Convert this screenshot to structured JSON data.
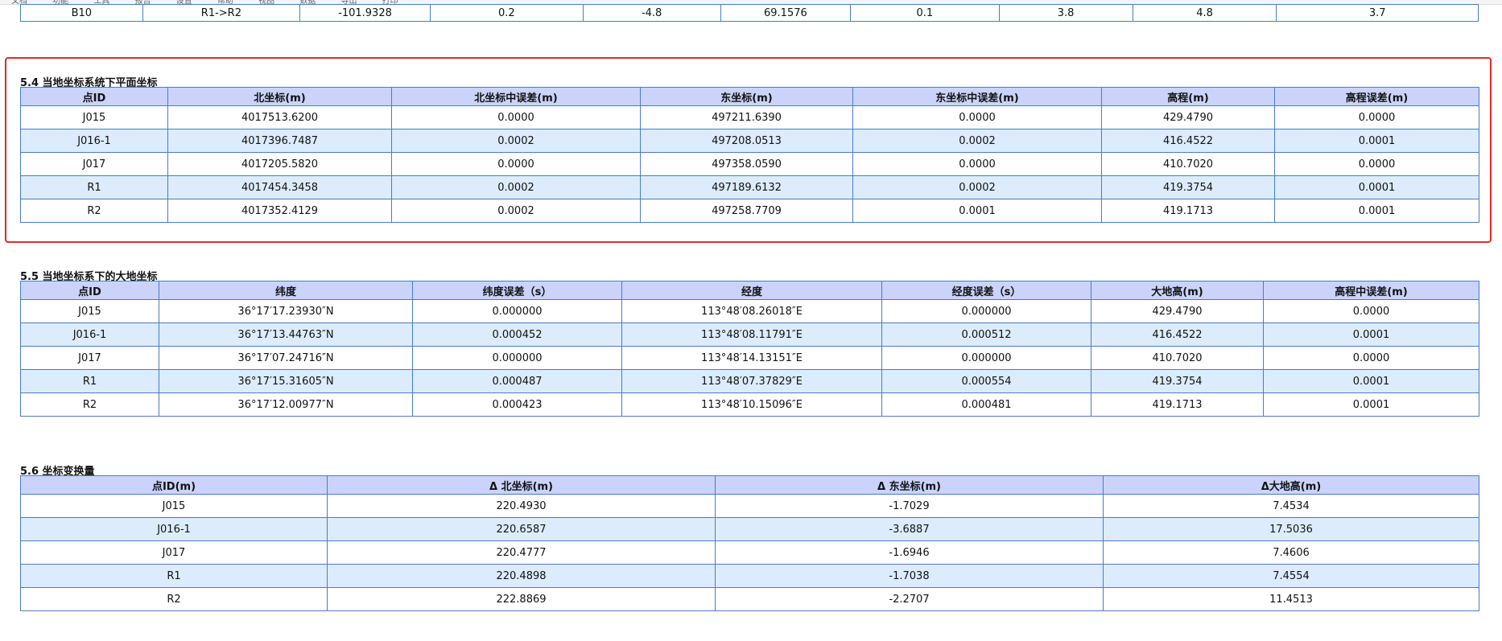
{
  "topbar": {
    "items": [
      "文档",
      "功能",
      "工具",
      "报告",
      "设置",
      "帮助",
      "视图",
      "数据",
      "导出",
      "打印"
    ]
  },
  "top_table": {
    "row": [
      "B10",
      "R1->R2",
      "-101.9328",
      "0.2",
      "-4.8",
      "69.1576",
      "0.1",
      "3.8",
      "4.8",
      "3.7"
    ]
  },
  "section_54": {
    "title": "5.4 当地坐标系统下平面坐标",
    "headers": [
      "点ID",
      "北坐标(m)",
      "北坐标中误差(m)",
      "东坐标(m)",
      "东坐标中误差(m)",
      "高程(m)",
      "高程误差(m)"
    ],
    "rows": [
      [
        "J015",
        "4017513.6200",
        "0.0000",
        "497211.6390",
        "0.0000",
        "429.4790",
        "0.0000"
      ],
      [
        "J016-1",
        "4017396.7487",
        "0.0002",
        "497208.0513",
        "0.0002",
        "416.4522",
        "0.0001"
      ],
      [
        "J017",
        "4017205.5820",
        "0.0000",
        "497358.0590",
        "0.0000",
        "410.7020",
        "0.0000"
      ],
      [
        "R1",
        "4017454.3458",
        "0.0002",
        "497189.6132",
        "0.0002",
        "419.3754",
        "0.0001"
      ],
      [
        "R2",
        "4017352.4129",
        "0.0002",
        "497258.7709",
        "0.0001",
        "419.1713",
        "0.0001"
      ]
    ]
  },
  "section_55": {
    "title": "5.5 当地坐标系下的大地坐标",
    "headers": [
      "点ID",
      "纬度",
      "纬度误差（s）",
      "经度",
      "经度误差（s）",
      "大地高(m)",
      "高程中误差(m)"
    ],
    "rows": [
      [
        "J015",
        "36°17′17.23930″N",
        "0.000000",
        "113°48′08.26018″E",
        "0.000000",
        "429.4790",
        "0.0000"
      ],
      [
        "J016-1",
        "36°17′13.44763″N",
        "0.000452",
        "113°48′08.11791″E",
        "0.000512",
        "416.4522",
        "0.0001"
      ],
      [
        "J017",
        "36°17′07.24716″N",
        "0.000000",
        "113°48′14.13151″E",
        "0.000000",
        "410.7020",
        "0.0000"
      ],
      [
        "R1",
        "36°17′15.31605″N",
        "0.000487",
        "113°48′07.37829″E",
        "0.000554",
        "419.3754",
        "0.0001"
      ],
      [
        "R2",
        "36°17′12.00977″N",
        "0.000423",
        "113°48′10.15096″E",
        "0.000481",
        "419.1713",
        "0.0001"
      ]
    ]
  },
  "section_56": {
    "title": "5.6 坐标变换量",
    "headers": [
      "点ID(m)",
      "Δ 北坐标(m)",
      "Δ 东坐标(m)",
      "Δ大地高(m)"
    ],
    "rows": [
      [
        "J015",
        "220.4930",
        "-1.7029",
        "7.4534"
      ],
      [
        "J016-1",
        "220.6587",
        "-3.6887",
        "17.5036"
      ],
      [
        "J017",
        "220.4777",
        "-1.6946",
        "7.4606"
      ],
      [
        "R1",
        "220.4898",
        "-1.7038",
        "7.4554"
      ],
      [
        "R2",
        "222.8869",
        "-2.2707",
        "11.4513"
      ]
    ]
  },
  "colors": {
    "header_bg": "#cbd3fb",
    "alt_row_bg": "#dcecfc",
    "border": "#4a7cc0",
    "highlight": "#e02b2b"
  }
}
